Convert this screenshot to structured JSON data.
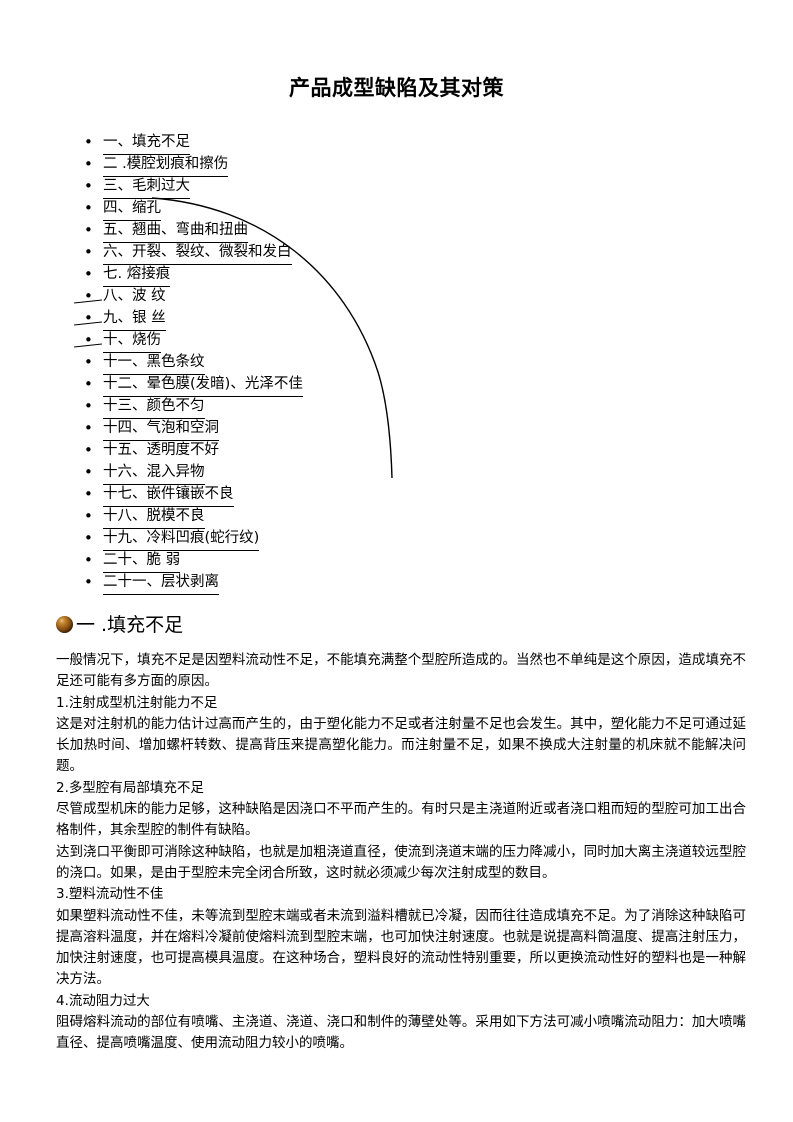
{
  "document": {
    "title": "产品成型缺陷及其对策",
    "background_color": "#ffffff",
    "text_color": "#000000"
  },
  "toc": {
    "items": [
      {
        "label": "一、填充不足",
        "underlined": true,
        "stub": false
      },
      {
        "label": "二 .模腔划痕和擦伤",
        "underlined": true,
        "stub": false
      },
      {
        "label": "三、毛刺过大",
        "underlined": true,
        "stub": false
      },
      {
        "label": "四、缩孔",
        "underlined": true,
        "stub": false
      },
      {
        "label": "五、翘曲、弯曲和扭曲",
        "underlined": true,
        "stub": false
      },
      {
        "label": "六、开裂、裂纹、微裂和发白",
        "underlined": true,
        "stub": false
      },
      {
        "label": "七. 熔接痕",
        "underlined": true,
        "stub": false
      },
      {
        "label": "八、波 纹",
        "underlined": false,
        "stub": true
      },
      {
        "label": "九、银 丝",
        "underlined": true,
        "stub": true
      },
      {
        "label": "十、烧伤",
        "underlined": true,
        "stub": true
      },
      {
        "label": "十一、黑色条纹",
        "underlined": true,
        "stub": false
      },
      {
        "label": "十二、晕色膜(发暗)、光泽不佳",
        "underlined": true,
        "stub": false
      },
      {
        "label": "十三、颜色不匀",
        "underlined": true,
        "stub": false
      },
      {
        "label": "十四、气泡和空洞",
        "underlined": true,
        "stub": false
      },
      {
        "label": "十五、透明度不好",
        "underlined": false,
        "stub": false
      },
      {
        "label": "十六、混入异物",
        "underlined": true,
        "stub": false
      },
      {
        "label": "十七、嵌件镶嵌不良",
        "underlined": true,
        "stub": false
      },
      {
        "label": "十八、脱模不良",
        "underlined": true,
        "stub": false
      },
      {
        "label": "十九、冷料凹痕(蛇行纹)",
        "underlined": true,
        "stub": false
      },
      {
        "label": "二十、脆 弱",
        "underlined": true,
        "stub": false
      },
      {
        "label": "二十一、层状剥离",
        "underlined": true,
        "stub": false
      }
    ]
  },
  "section": {
    "bullet_icon": "brown-sphere-icon",
    "bullet_color": "#8a5314",
    "heading": "一 .填充不足"
  },
  "body": {
    "paragraphs": [
      "一般情况下，填充不足是因塑料流动性不足，不能填充满整个型腔所造成的。当然也不单纯是这个原因，造成填充不足还可能有多方面的原因。",
      "1.注射成型机注射能力不足",
      "这是对注射机的能力估计过高而产生的，由于塑化能力不足或者注射量不足也会发生。其中，塑化能力不足可通过延长加热时间、增加螺杆转数、提高背压来提高塑化能力。而注射量不足，如果不换成大注射量的机床就不能解决问题。",
      "2.多型腔有局部填充不足",
      "尽管成型机床的能力足够，这种缺陷是因浇口不平而产生的。有时只是主浇道附近或者浇口粗而短的型腔可加工出合格制件，其余型腔的制件有缺陷。",
      "达到浇口平衡即可消除这种缺陷，也就是加粗浇道直径，使流到浇道末端的压力降减小，同时加大离主浇道较远型腔的浇口。如果，是由于型腔未完全闭合所致，这时就必须减少每次注射成型的数目。",
      "3.塑料流动性不佳",
      "如果塑料流动性不佳，未等流到型腔末端或者未流到溢料槽就已冷凝，因而往往造成填充不足。为了消除这种缺陷可提高溶料温度，并在熔料冷凝前使熔料流到型腔末端，也可加快注射速度。也就是说提高料筒温度、提高注射压力，加快注射速度，也可提高模具温度。在这种场合，塑料良好的流动性特别重要，所以更换流动性好的塑料也是一种解决方法。",
      "4.流动阻力过大",
      "阻碍熔料流动的部位有喷嘴、主浇道、浇道、浇口和制件的薄壁处等。采用如下方法可减小喷嘴流动阻力：加大喷嘴直径、提高喷嘴温度、使用流动阻力较小的喷嘴。"
    ]
  },
  "decoration": {
    "arc_name": "curved-arc-line",
    "arc_color": "#000000"
  }
}
